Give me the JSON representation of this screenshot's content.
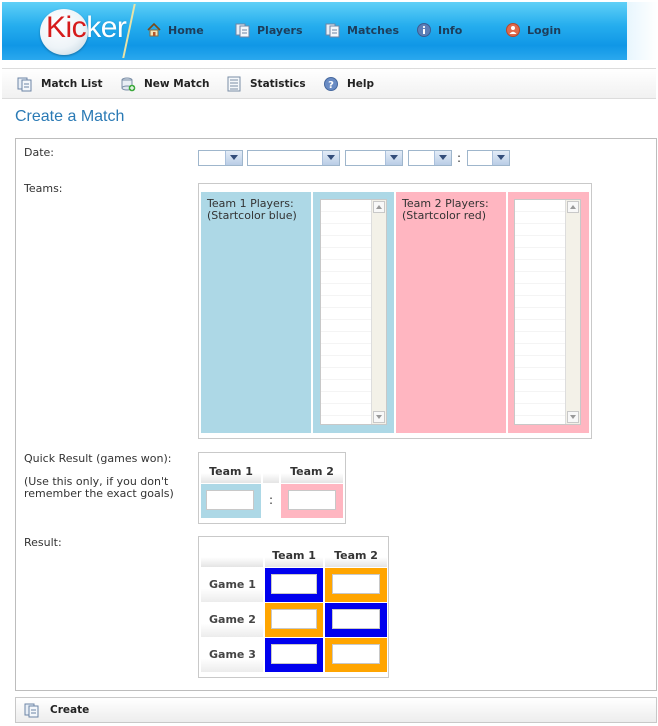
{
  "app": {
    "logo_text_part1": "Kic",
    "logo_text_part2": "ker"
  },
  "topnav": {
    "items": [
      {
        "label": "Home",
        "icon": "home-icon"
      },
      {
        "label": "Players",
        "icon": "players-icon"
      },
      {
        "label": "Matches",
        "icon": "matches-icon"
      },
      {
        "label": "Info",
        "icon": "info-icon"
      },
      {
        "label": "Login",
        "icon": "login-icon"
      }
    ]
  },
  "subnav": {
    "items": [
      {
        "label": "Match List",
        "icon": "match-list-icon"
      },
      {
        "label": "New Match",
        "icon": "new-match-icon"
      },
      {
        "label": "Statistics",
        "icon": "statistics-icon"
      },
      {
        "label": "Help",
        "icon": "help-icon"
      }
    ]
  },
  "page": {
    "title": "Create a Match"
  },
  "form": {
    "date_label": "Date:",
    "date_separator": ":",
    "teams_label": "Teams:",
    "team1_label": "Team 1 Players: (Startcolor blue)",
    "team2_label": "Team 2 Players: (Startcolor red)",
    "quick_result_label": "Quick Result (games won):",
    "quick_result_note": "(Use this only, if you don't remember the exact goals)",
    "quick_result": {
      "team1_header": "Team 1",
      "team2_header": "Team 2",
      "separator": ":"
    },
    "result_label": "Result:",
    "result": {
      "team1_header": "Team 1",
      "team2_header": "Team 2",
      "games": [
        "Game 1",
        "Game 2",
        "Game 3"
      ]
    },
    "create_label": "Create"
  },
  "colors": {
    "team1": "#add8e6",
    "team2": "#ffb6c1",
    "blue_side": "#0000ee",
    "orange_side": "#ffa500",
    "title": "#2a7ab5"
  }
}
